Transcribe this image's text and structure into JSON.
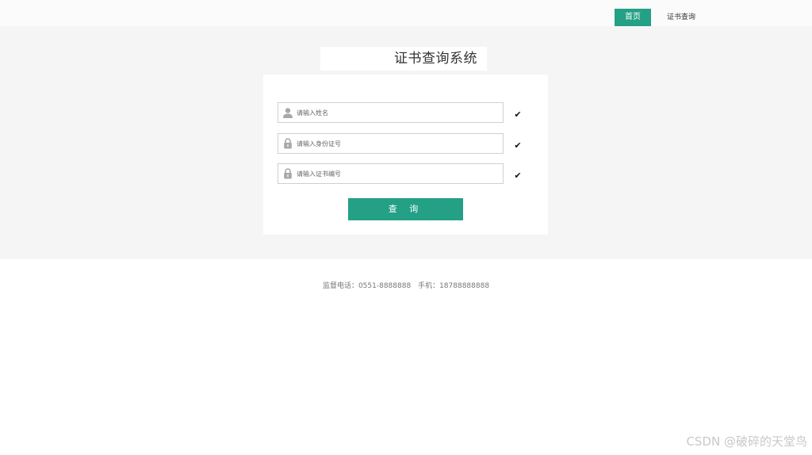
{
  "nav": {
    "home_label": "首页",
    "cert_query_label": "证书查询"
  },
  "main": {
    "title": "证书查询系统",
    "fields": {
      "name_placeholder": "请输入姓名",
      "id_placeholder": "请输入身份证号",
      "cert_placeholder": "请输入证书编号"
    },
    "check_mark": "✔",
    "query_label": "查 询"
  },
  "footer": {
    "phone": "监督电话：0551-8888888",
    "mobile": "手机：18788888888"
  },
  "watermark": "CSDN @破碎的天堂鸟",
  "colors": {
    "accent": "#23a085",
    "band": "#f5f5f5"
  }
}
